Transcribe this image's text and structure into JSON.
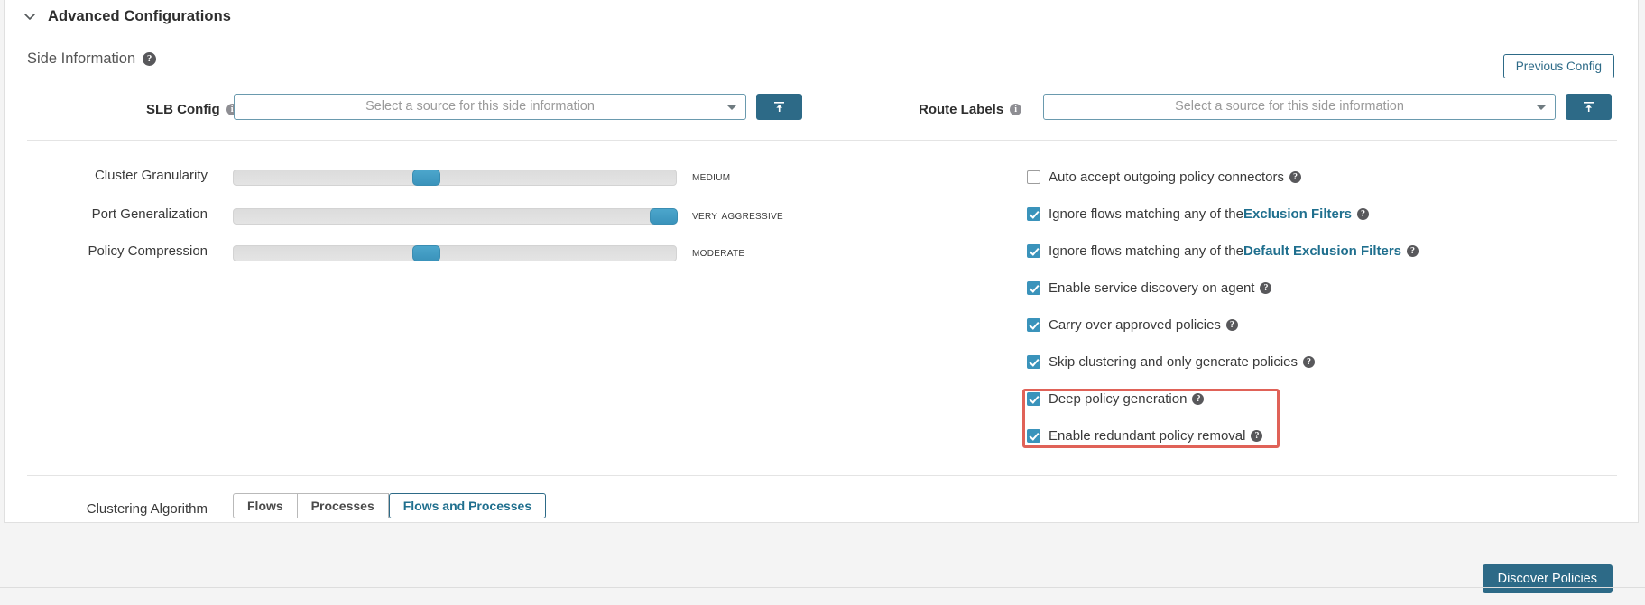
{
  "header": {
    "title": "Advanced Configurations",
    "collapse_icon": "chevron-down-icon"
  },
  "side_information": {
    "label": "Side Information",
    "help_icon": "help-icon",
    "previous_config_label": "Previous Config",
    "fields": [
      {
        "label": "SLB Config",
        "info_icon": "info-icon",
        "placeholder": "Select a source for this side information",
        "value": "",
        "upload_icon": "upload-icon"
      },
      {
        "label": "Route Labels",
        "info_icon": "info-icon",
        "placeholder": "Select a source for this side information",
        "value": "",
        "upload_icon": "upload-icon"
      }
    ]
  },
  "sliders": [
    {
      "label": "Cluster Granularity",
      "value": "Medium",
      "percent": 43
    },
    {
      "label": "Port Generalization",
      "value": "Very Aggressive",
      "percent": 100
    },
    {
      "label": "Policy Compression",
      "value": "Moderate",
      "percent": 43
    }
  ],
  "checkboxes": [
    {
      "checked": false,
      "text": "Auto accept outgoing policy connectors",
      "link": "",
      "tail": "",
      "help_icon": "help-icon"
    },
    {
      "checked": true,
      "text": "Ignore flows matching any of the ",
      "link": "Exclusion Filters",
      "tail": "",
      "help_icon": "help-icon"
    },
    {
      "checked": true,
      "text": "Ignore flows matching any of the ",
      "link": "Default Exclusion Filters",
      "tail": "",
      "help_icon": "help-icon"
    },
    {
      "checked": true,
      "text": "Enable service discovery on agent",
      "link": "",
      "tail": "",
      "help_icon": "help-icon"
    },
    {
      "checked": true,
      "text": "Carry over approved policies",
      "link": "",
      "tail": "",
      "help_icon": "help-icon"
    },
    {
      "checked": true,
      "text": "Skip clustering and only generate policies",
      "link": "",
      "tail": "",
      "help_icon": "help-icon"
    },
    {
      "checked": true,
      "text": "Deep policy generation",
      "link": "",
      "tail": "",
      "help_icon": "help-icon"
    },
    {
      "checked": true,
      "text": "Enable redundant policy removal",
      "link": "",
      "tail": "",
      "help_icon": "help-icon"
    }
  ],
  "highlight": {
    "color": "#e06258",
    "covers": [
      "Deep policy generation",
      "Enable redundant policy removal"
    ]
  },
  "clustering_algorithm": {
    "label": "Clustering Algorithm",
    "options": [
      {
        "label": "Flows",
        "selected": false
      },
      {
        "label": "Processes",
        "selected": false
      },
      {
        "label": "Flows and Processes",
        "selected": true
      }
    ]
  },
  "footer": {
    "discover_label": "Discover Policies"
  },
  "colors": {
    "accent": "#2d6a87",
    "link": "#1f6f8e",
    "slider_thumb": "#3a93bb",
    "checkbox_checked": "#3a93bb",
    "highlight": "#e06258"
  }
}
